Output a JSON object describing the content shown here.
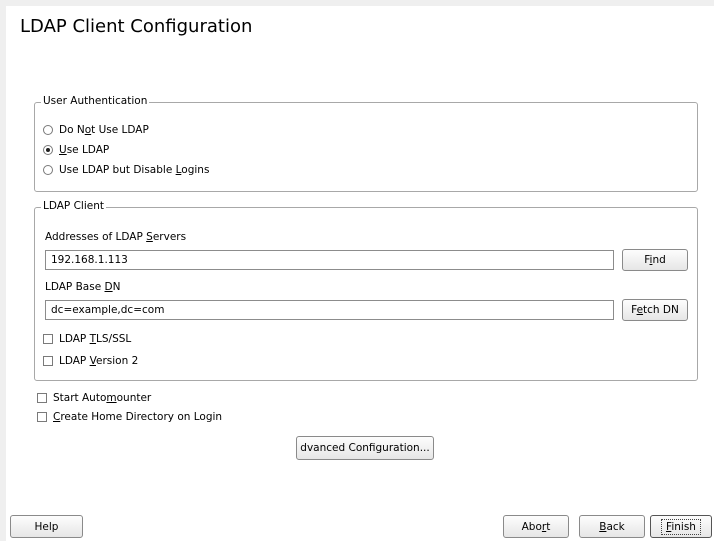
{
  "title": "LDAP Client Configuration",
  "user_auth": {
    "legend": "User Authentication",
    "options": [
      {
        "pre": "Do N",
        "u": "o",
        "post": "t Use LDAP",
        "selected": false
      },
      {
        "pre": "",
        "u": "U",
        "post": "se LDAP",
        "selected": true
      },
      {
        "pre": "Use LDAP but Disable ",
        "u": "L",
        "post": "ogins",
        "selected": false
      }
    ]
  },
  "ldap_client": {
    "legend": "LDAP Client",
    "servers": {
      "pre": "Addresses of LDAP ",
      "u": "S",
      "post": "ervers",
      "value": "192.168.1.113"
    },
    "find_button": {
      "pre": "F",
      "u": "i",
      "post": "nd"
    },
    "base_dn": {
      "pre": "LDAP Base ",
      "u": "D",
      "post": "N",
      "value": "dc=example,dc=com"
    },
    "fetch_button": {
      "pre": "F",
      "u": "e",
      "post": "tch DN"
    },
    "tls": {
      "pre": "LDAP ",
      "u": "T",
      "post": "LS/SSL",
      "checked": false
    },
    "version2": {
      "pre": "LDAP ",
      "u": "V",
      "post": "ersion 2",
      "checked": false
    }
  },
  "automounter": {
    "pre": "Start Auto",
    "u": "m",
    "post": "ounter",
    "checked": false
  },
  "home_dir": {
    "pre": "",
    "u": "C",
    "post": "reate Home Directory on Login",
    "checked": false
  },
  "advanced_button": {
    "pre": "",
    "u": "A",
    "post": "dvanced Configuration..."
  },
  "footer": {
    "help": "Help",
    "abort": {
      "pre": "Abo",
      "u": "r",
      "post": "t"
    },
    "back": {
      "pre": "",
      "u": "B",
      "post": "ack"
    },
    "finish": {
      "pre": "",
      "u": "F",
      "post": "inish"
    }
  },
  "colors": {
    "window_bg": "#efefef",
    "panel_bg": "#ffffff",
    "border": "#a8a8a8"
  }
}
